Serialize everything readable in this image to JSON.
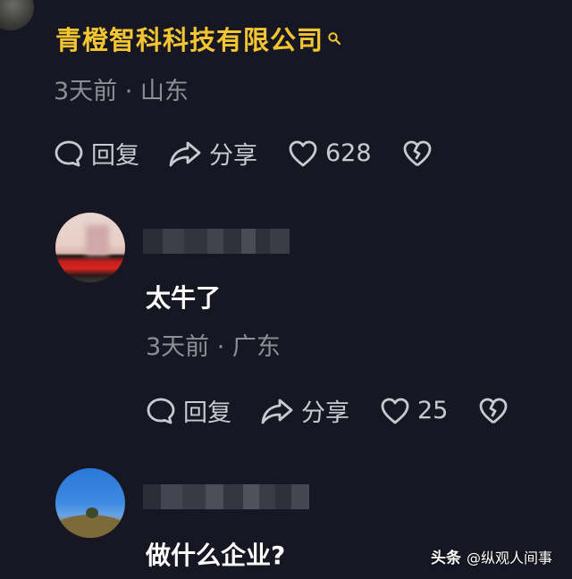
{
  "top_comment": {
    "author": "青橙智科科技有限公司",
    "meta": "3天前 · 山东",
    "actions": {
      "reply": "回复",
      "share": "分享",
      "likes": "628"
    }
  },
  "replies": [
    {
      "text": "太牛了",
      "meta": "3天前 · 广东",
      "actions": {
        "reply": "回复",
        "share": "分享",
        "likes": "25"
      }
    },
    {
      "text": "做什么企业?"
    }
  ],
  "watermark": {
    "brand": "头条",
    "account": "@纵观人间事"
  },
  "colors": {
    "background": "#161722",
    "author_highlight": "#f3c533",
    "meta": "#8d8f98",
    "action": "#c9cad0"
  },
  "icons": [
    "search-icon",
    "comment-bubble-icon",
    "share-arrow-icon",
    "heart-icon",
    "broken-heart-icon"
  ]
}
